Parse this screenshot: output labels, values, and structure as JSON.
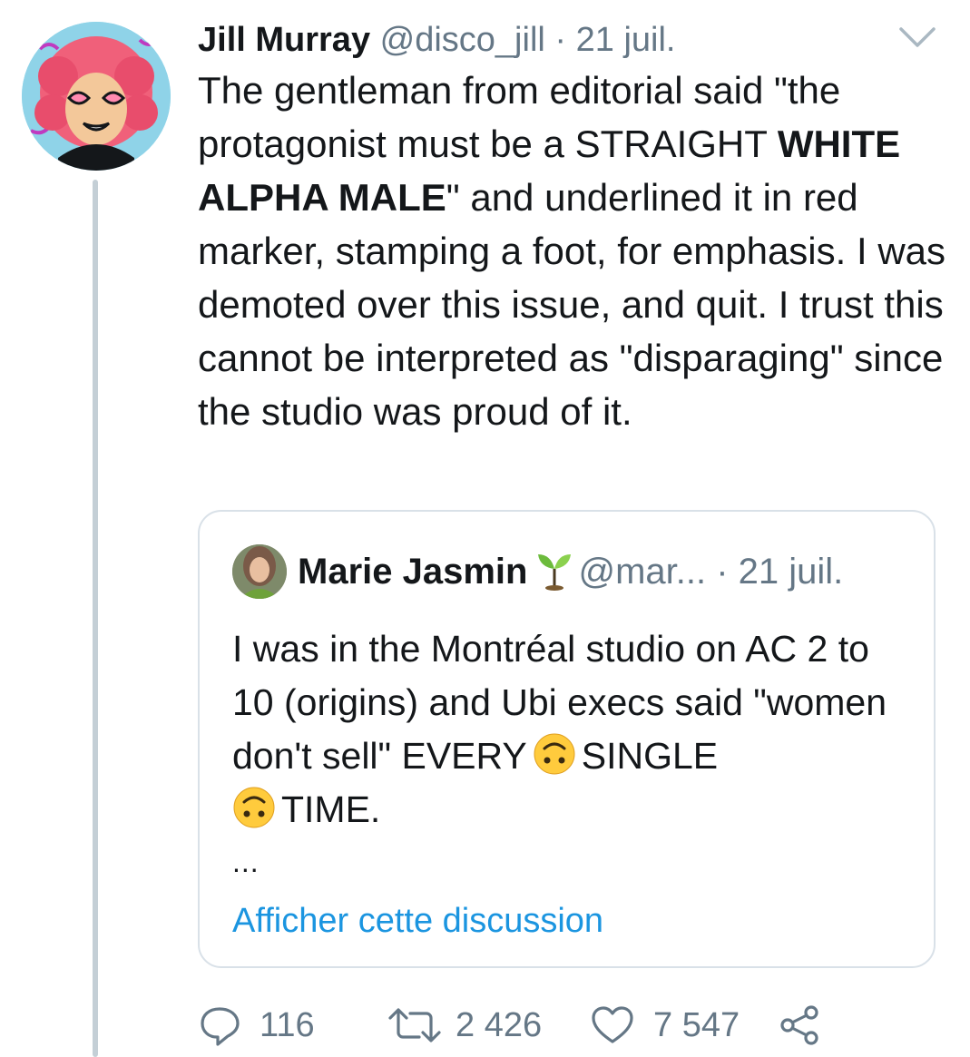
{
  "tweet": {
    "author_name": "Jill Murray",
    "handle": "@disco_jill",
    "separator": " · ",
    "date": "21 juil.",
    "text_part1": "The gentleman from editorial said \"the protagonist must be a STRAIGHT ",
    "text_bold": "WHITE ALPHA MALE",
    "text_part2": "\" and underlined it in red marker, stamping a foot, for emphasis. I was demoted over this issue, and quit. I trust this cannot be interpreted as \"disparaging\" since the studio was proud of it."
  },
  "quoted_tweet": {
    "author_name": "Marie Jasmin",
    "author_emoji": "seedling-emoji",
    "handle": "@mar...",
    "separator": " · ",
    "date": "21 juil.",
    "text_part1": "I was in the Montréal studio on AC 2 to 10 (origins) and Ubi execs said \"women don't sell\" EVERY",
    "text_part2": "SINGLE",
    "text_part3": "TIME.",
    "inline_emoji": "upside-down-face-emoji",
    "ellipsis": "...",
    "show_thread_link": "Afficher cette discussion"
  },
  "actions": {
    "replies": "116",
    "retweets": "2 426",
    "likes": "7 547"
  },
  "colors": {
    "text": "#14171a",
    "muted": "#657786",
    "link": "#1b95e0",
    "border": "#d9e1e8",
    "thread_line": "#c4cfd6"
  }
}
